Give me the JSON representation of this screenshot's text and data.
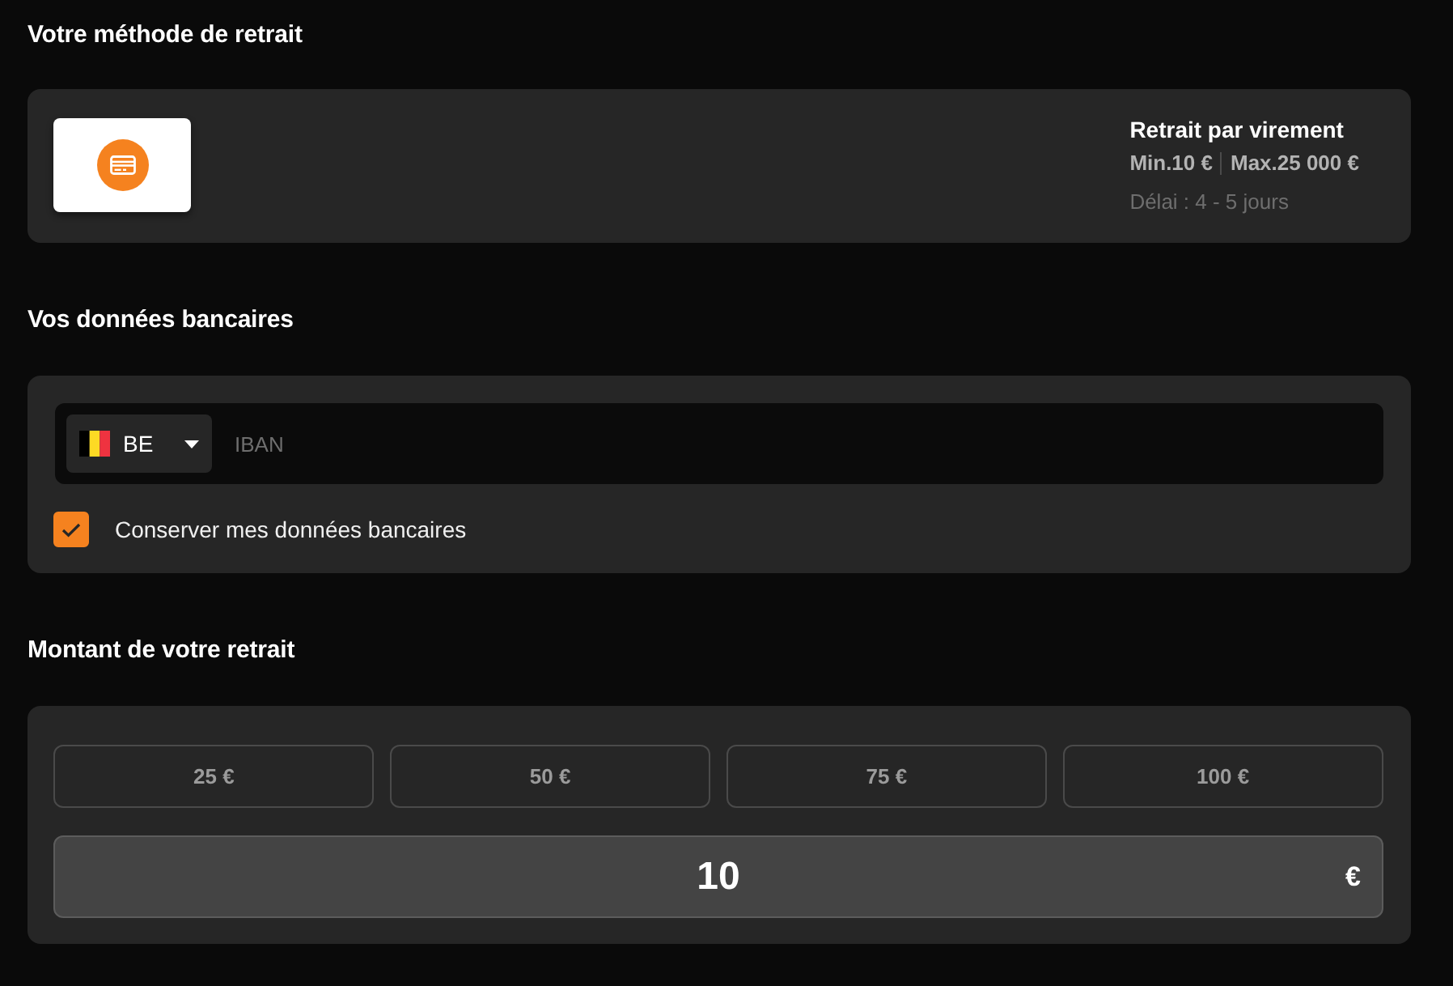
{
  "withdrawal_method": {
    "heading": "Votre méthode de retrait",
    "method": {
      "title": "Retrait par virement",
      "min": "Min.10 €",
      "max": "Max.25 000 €",
      "delay": "Délai : 4 - 5 jours"
    }
  },
  "bank_details": {
    "heading": "Vos données bancaires",
    "country": {
      "code": "BE"
    },
    "iban": {
      "placeholder": "IBAN"
    },
    "save_details": {
      "label": "Conserver mes données bancaires",
      "checked": true
    }
  },
  "amount": {
    "heading": "Montant de votre retrait",
    "presets": [
      {
        "label": "25 €",
        "selected": false
      },
      {
        "label": "50 €",
        "selected": false
      },
      {
        "label": "75 €",
        "selected": false
      },
      {
        "label": "100 €",
        "selected": false
      }
    ],
    "value": "10",
    "currency": "€"
  }
}
